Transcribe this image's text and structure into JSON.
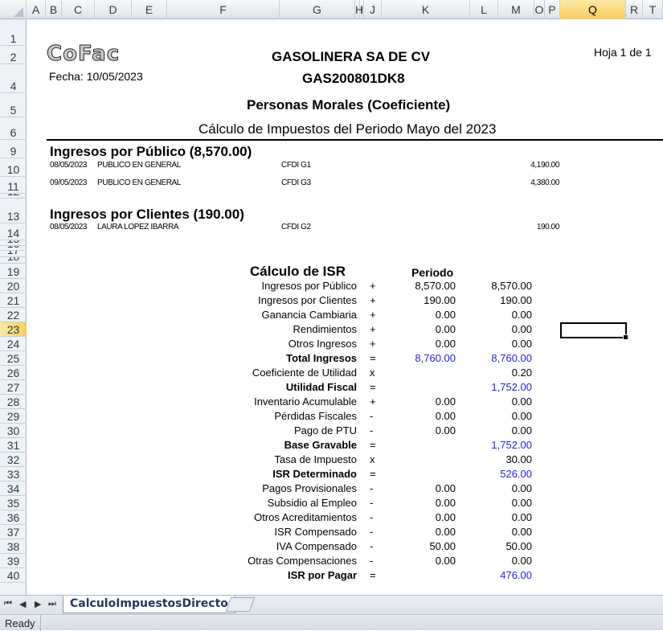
{
  "columns": [
    "A",
    "B",
    "C",
    "D",
    "E",
    "F",
    "G",
    "H",
    "I",
    "J",
    "K",
    "L",
    "M",
    "O",
    "P",
    "Q",
    "R",
    "T"
  ],
  "selected_cell": "Q23",
  "header": {
    "logo_text": "CoFac",
    "company": "GASOLINERA SA DE CV",
    "rfc": "GAS200801DK8",
    "page": "Hoja 1 de 1",
    "fecha": "Fecha: 10/05/2023",
    "regimen": "Personas Morales (Coeficiente)",
    "periodo_title": "Cálculo de Impuestos del Periodo Mayo del 2023"
  },
  "publico": {
    "title": "Ingresos por Público (8,570.00)",
    "rows": [
      {
        "fecha": "08/05/2023",
        "nombre": "PUBLICO EN GENERAL",
        "cfdi": "CFDI G1",
        "importe": "4,190.00"
      },
      {
        "fecha": "09/05/2023",
        "nombre": "PUBLICO EN GENERAL",
        "cfdi": "CFDI G3",
        "importe": "4,380.00"
      }
    ]
  },
  "clientes": {
    "title": "Ingresos por Clientes (190.00)",
    "rows": [
      {
        "fecha": "08/05/2023",
        "nombre": "LAURA LOPEZ IBARRA",
        "cfdi": "CFDI G2",
        "importe": "190.00"
      }
    ]
  },
  "isr": {
    "title": "Cálculo de ISR",
    "periodo_header": "Periodo",
    "blue_color": "#1f1fe0",
    "rows": [
      {
        "label": "Ingresos por Público",
        "op": "+",
        "periodo": "8,570.00",
        "total": "8,570.00"
      },
      {
        "label": "Ingresos por Clientes",
        "op": "+",
        "periodo": "190.00",
        "total": "190.00"
      },
      {
        "label": "Ganancia Cambiaria",
        "op": "+",
        "periodo": "0.00",
        "total": "0.00"
      },
      {
        "label": "Rendimientos",
        "op": "+",
        "periodo": "0.00",
        "total": "0.00"
      },
      {
        "label": "Otros Ingresos",
        "op": "+",
        "periodo": "0.00",
        "total": "0.00"
      },
      {
        "label": "Total Ingresos",
        "op": "=",
        "periodo": "8,760.00",
        "total": "8,760.00",
        "bold": true,
        "blue": true
      },
      {
        "label": "Coeficiente de Utilidad",
        "op": "x",
        "periodo": "",
        "total": "0.20"
      },
      {
        "label": "Utilidad Fiscal",
        "op": "=",
        "periodo": "",
        "total": "1,752.00",
        "bold": true,
        "blue": true
      },
      {
        "label": "Inventario Acumulable",
        "op": "+",
        "periodo": "0.00",
        "total": "0.00"
      },
      {
        "label": "Pérdidas Fiscales",
        "op": "-",
        "periodo": "0.00",
        "total": "0.00"
      },
      {
        "label": "Pago de PTU",
        "op": "-",
        "periodo": "0.00",
        "total": "0.00"
      },
      {
        "label": "Base Gravable",
        "op": "=",
        "periodo": "",
        "total": "1,752.00",
        "bold": true,
        "blue": true
      },
      {
        "label": "Tasa de Impuesto",
        "op": "x",
        "periodo": "",
        "total": "30.00"
      },
      {
        "label": "ISR Determinado",
        "op": "=",
        "periodo": "",
        "total": "526.00",
        "bold": true,
        "blue": true
      },
      {
        "label": "Pagos Provisionales",
        "op": "-",
        "periodo": "0.00",
        "total": "0.00"
      },
      {
        "label": "Subsidio al Empleo",
        "op": "-",
        "periodo": "0.00",
        "total": "0.00"
      },
      {
        "label": "Otros Acreditamientos",
        "op": "-",
        "periodo": "0.00",
        "total": "0.00"
      },
      {
        "label": "ISR Compensado",
        "op": "-",
        "periodo": "0.00",
        "total": "0.00"
      },
      {
        "label": "IVA Compensado",
        "op": "-",
        "periodo": "50.00",
        "total": "50.00"
      },
      {
        "label": "Otras Compensaciones",
        "op": "-",
        "periodo": "0.00",
        "total": "0.00"
      },
      {
        "label": "ISR por Pagar",
        "op": "=",
        "periodo": "",
        "total": "476.00",
        "bold": true,
        "blue": true
      }
    ]
  },
  "sheet_tab": "CalculoImpuestosDirecto",
  "status": "Ready"
}
